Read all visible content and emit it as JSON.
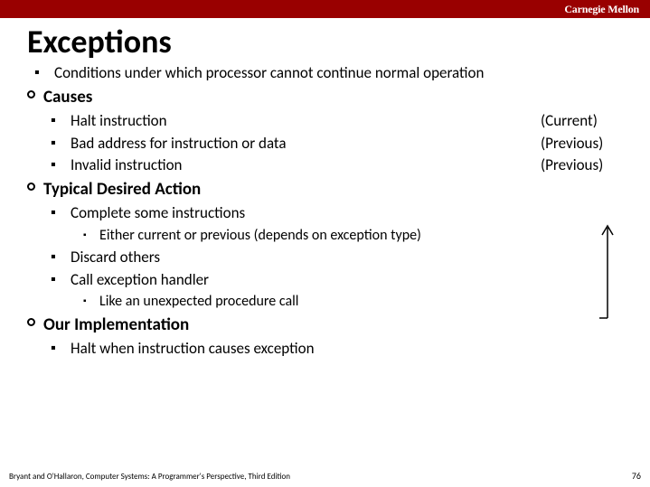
{
  "brand": "Carnegie Mellon",
  "title": "Exceptions",
  "intro": "Conditions under which processor cannot continue normal operation",
  "sections": {
    "causes": {
      "head": "Causes",
      "items": [
        {
          "label": "Halt instruction",
          "tag": "(Current)"
        },
        {
          "label": "Bad address for instruction or data",
          "tag": "(Previous)"
        },
        {
          "label": "Invalid instruction",
          "tag": "(Previous)"
        }
      ]
    },
    "action": {
      "head": "Typical Desired Action",
      "items": {
        "a": "Complete some instructions",
        "a_sub": "Either current or previous (depends on exception type)",
        "b": "Discard others",
        "c": "Call exception handler",
        "c_sub": "Like an unexpected procedure call"
      }
    },
    "impl": {
      "head": "Our Implementation",
      "item": "Halt when instruction causes exception"
    }
  },
  "footer": "Bryant and O'Hallaron, Computer Systems: A Programmer's Perspective, Third Edition",
  "page": "76"
}
